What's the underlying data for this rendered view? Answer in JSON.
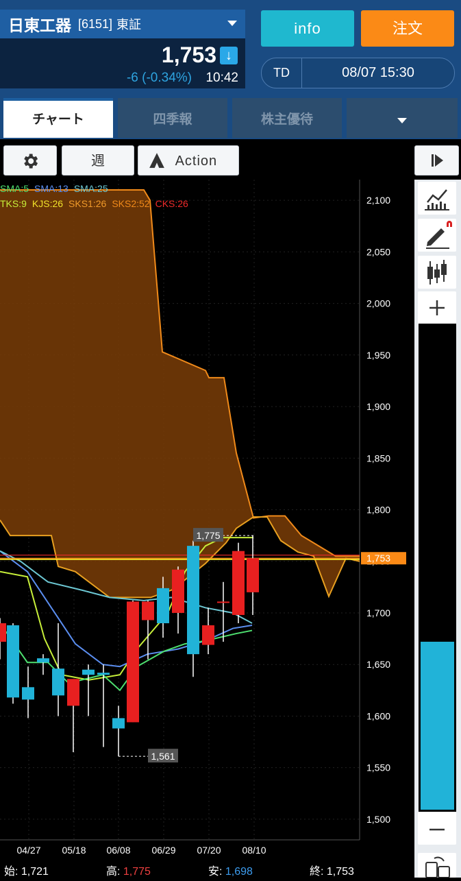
{
  "header": {
    "stock_name": "日東工器",
    "stock_code": "[6151]",
    "exchange": "東証",
    "price": "1,753",
    "change": "-6 (-0.34%)",
    "time": "10:42",
    "info_label": "info",
    "order_label": "注文",
    "td_label": "TD",
    "td_datetime": "08/07 15:30"
  },
  "tabs": [
    "チャート",
    "四季報",
    "株主優待"
  ],
  "toolbar": {
    "period_label": "週",
    "action_label": "Action"
  },
  "indicators": {
    "row1": [
      {
        "label": "SMA:5",
        "color": "#4ee070"
      },
      {
        "label": "SMA:13",
        "color": "#5b8ef0"
      },
      {
        "label": "SMA:25",
        "color": "#6cc7d3"
      }
    ],
    "row2": [
      {
        "label": "TKS:9",
        "color": "#c7ef3a"
      },
      {
        "label": "KJS:26",
        "color": "#f0e22a"
      },
      {
        "label": "SKS1:26",
        "color": "#f09a2a"
      },
      {
        "label": "SKS2:52",
        "color": "#f08a1a"
      },
      {
        "label": "CKS:26",
        "color": "#ef2a2a"
      }
    ]
  },
  "chart_data": {
    "type": "candlestick",
    "ylim": [
      1480,
      2120
    ],
    "y_ticks": [
      "2,100",
      "2,050",
      "2,000",
      "1,950",
      "1,900",
      "1,850",
      "1,800",
      "1,750",
      "1,700",
      "1,650",
      "1,600",
      "1,550",
      "1,500"
    ],
    "x_ticks": [
      "04/27",
      "05/18",
      "06/08",
      "06/29",
      "07/20",
      "08/10"
    ],
    "current_price_label": "1,753",
    "high_marker": "1,775",
    "low_marker": "1,561",
    "candles": [
      {
        "o": 1690,
        "h": 1695,
        "l": 1655,
        "c": 1672,
        "up": true
      },
      {
        "o": 1688,
        "h": 1690,
        "l": 1612,
        "c": 1618,
        "up": false
      },
      {
        "o": 1628,
        "h": 1648,
        "l": 1598,
        "c": 1616,
        "up": false
      },
      {
        "o": 1656,
        "h": 1660,
        "l": 1640,
        "c": 1652,
        "up": false
      },
      {
        "o": 1646,
        "h": 1690,
        "l": 1600,
        "c": 1620,
        "up": false
      },
      {
        "o": 1610,
        "h": 1635,
        "l": 1565,
        "c": 1636,
        "up": true
      },
      {
        "o": 1645,
        "h": 1650,
        "l": 1600,
        "c": 1640,
        "up": false
      },
      {
        "o": 1642,
        "h": 1650,
        "l": 1570,
        "c": 1640,
        "up": false
      },
      {
        "o": 1598,
        "h": 1610,
        "l": 1561,
        "c": 1588,
        "up": false
      },
      {
        "o": 1594,
        "h": 1712,
        "l": 1594,
        "c": 1711,
        "up": true
      },
      {
        "o": 1693,
        "h": 1712,
        "l": 1655,
        "c": 1711,
        "up": true
      },
      {
        "o": 1724,
        "h": 1735,
        "l": 1676,
        "c": 1690,
        "up": false
      },
      {
        "o": 1700,
        "h": 1745,
        "l": 1680,
        "c": 1742,
        "up": true
      },
      {
        "o": 1765,
        "h": 1770,
        "l": 1638,
        "c": 1660,
        "up": false
      },
      {
        "o": 1669,
        "h": 1705,
        "l": 1660,
        "c": 1688,
        "up": true
      },
      {
        "o": 1710,
        "h": 1730,
        "l": 1672,
        "c": 1711,
        "up": true
      },
      {
        "o": 1698,
        "h": 1768,
        "l": 1690,
        "c": 1760,
        "up": true
      },
      {
        "o": 1720,
        "h": 1775,
        "l": 1698,
        "c": 1753,
        "up": true
      }
    ],
    "candle_x": [
      0,
      19,
      41,
      63,
      85,
      107,
      129,
      151,
      173,
      194,
      216,
      238,
      260,
      282,
      304,
      326,
      348,
      369
    ]
  },
  "bottom": {
    "open_label": "始:",
    "open_value": "1,721",
    "high_label": "高:",
    "high_value": "1,775",
    "low_label": "安:",
    "low_value": "1,698",
    "close_label": "終:",
    "close_value": "1,753",
    "high_color": "#ef4040",
    "low_color": "#3d9df0"
  },
  "colors": {
    "up": "#e82020",
    "down": "#21b3d8",
    "cloud": "#7a3d07",
    "cloud_line": "#f08a1a",
    "volume_bar": "#21b3d8"
  }
}
